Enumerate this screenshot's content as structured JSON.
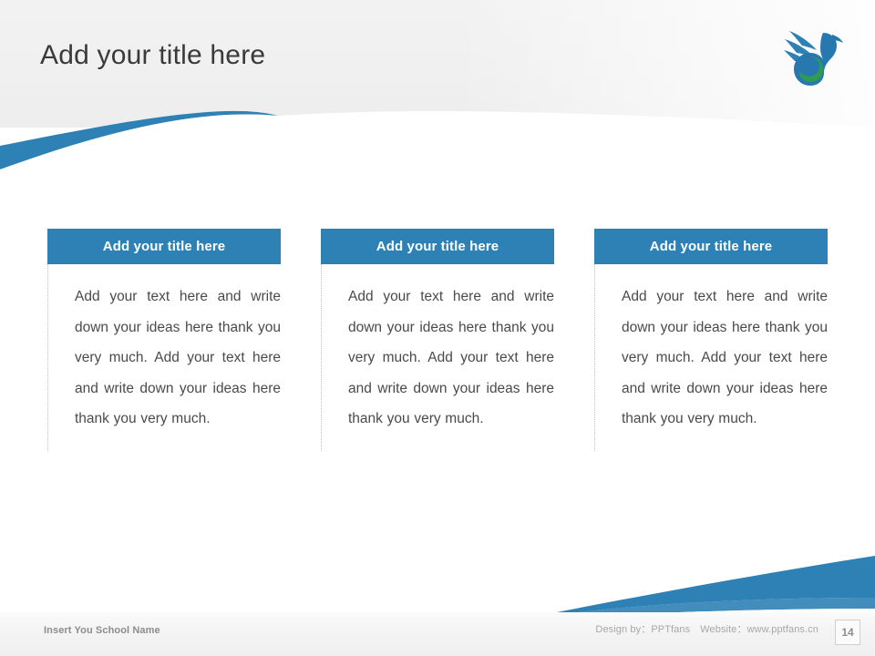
{
  "slide": {
    "title": "Add your title here",
    "accent_color": "#2E81B5",
    "logo": {
      "name": "swan-bird-logo",
      "wing_color": "#2E81B5",
      "body_color": "#2878B0",
      "crescent_color": "#2E9C4E"
    }
  },
  "columns": [
    {
      "header": "Add your title here",
      "body": "Add your text here and write down your ideas here thank you very much. Add your text here and write down your ideas here thank you very much."
    },
    {
      "header": "Add your title here",
      "body": "Add your text here and write down your ideas here thank you very much. Add your text here and write down your ideas here thank you very much."
    },
    {
      "header": "Add your title here",
      "body": "Add your text here and write down your ideas here thank you very much. Add your text here and write down your ideas here thank you very much."
    }
  ],
  "footer": {
    "school_placeholder": "Insert You School Name",
    "design_by_label": "Design by：",
    "design_by_value": "PPTfans",
    "website_label": "Website：",
    "website_value": "www.pptfans.cn",
    "page_number": "14"
  }
}
